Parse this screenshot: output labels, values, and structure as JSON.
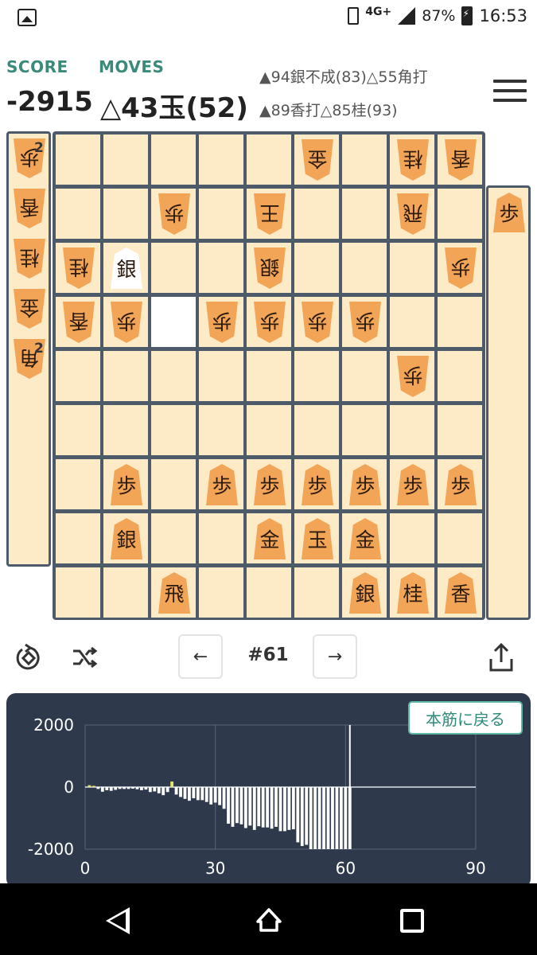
{
  "status_bar": {
    "network": "4G+",
    "battery": "87%",
    "time": "16:53"
  },
  "header": {
    "score_label": "SCORE",
    "moves_label": "MOVES",
    "score_value": "-2915",
    "move_value": "△43玉(52)",
    "pv_line1": "▲94銀不成(83)△55角打",
    "pv_line2": "▲89香打△85桂(93)"
  },
  "gote_hand": [
    {
      "piece": "歩",
      "count": "2"
    },
    {
      "piece": "香",
      "count": ""
    },
    {
      "piece": "桂",
      "count": ""
    },
    {
      "piece": "金",
      "count": ""
    },
    {
      "piece": "角",
      "count": "2"
    }
  ],
  "sente_hand": [
    {
      "piece": "歩",
      "count": ""
    }
  ],
  "board": [
    [
      "",
      "",
      "",
      "",
      "",
      "v金",
      "",
      "v桂",
      "v香"
    ],
    [
      "",
      "",
      "v歩",
      "",
      "v王",
      "",
      "",
      "v飛",
      ""
    ],
    [
      "v桂",
      "*銀",
      "",
      "",
      "v銀",
      "",
      "",
      "",
      "v歩"
    ],
    [
      "v香",
      "v歩",
      "#",
      "v歩",
      "v歩",
      "v歩",
      "v歩",
      "",
      ""
    ],
    [
      "",
      "",
      "",
      "",
      "",
      "",
      "",
      "v歩",
      ""
    ],
    [
      "",
      "",
      "",
      "",
      "",
      "",
      "",
      "",
      ""
    ],
    [
      "",
      "歩",
      "",
      "歩",
      "歩",
      "歩",
      "歩",
      "歩",
      "歩"
    ],
    [
      "",
      "銀",
      "",
      "",
      "金",
      "玉",
      "金",
      "",
      ""
    ],
    [
      "",
      "",
      "飛",
      "",
      "",
      "",
      "銀",
      "桂",
      "香"
    ]
  ],
  "controls": {
    "prev": "←",
    "next": "→",
    "move_number": "#61"
  },
  "chart_button": "本筋に戻る",
  "chart_data": {
    "type": "bar",
    "xlabel": "",
    "ylabel": "",
    "xlim": [
      0,
      90
    ],
    "ylim": [
      -2000,
      2000
    ],
    "yticks": [
      "2000",
      "0",
      "-2000"
    ],
    "xticks": [
      "0",
      "30",
      "60",
      "90"
    ],
    "current_move": 61,
    "x": [
      1,
      2,
      3,
      4,
      5,
      6,
      7,
      8,
      9,
      10,
      11,
      12,
      13,
      14,
      15,
      16,
      17,
      18,
      19,
      20,
      21,
      22,
      23,
      24,
      25,
      26,
      27,
      28,
      29,
      30,
      31,
      32,
      33,
      34,
      35,
      36,
      37,
      38,
      39,
      40,
      41,
      42,
      43,
      44,
      45,
      46,
      47,
      48,
      49,
      50,
      51,
      52,
      53,
      54,
      55,
      56,
      57,
      58,
      59,
      60,
      61
    ],
    "values": [
      60,
      40,
      -60,
      -150,
      -100,
      -120,
      -90,
      -60,
      -60,
      -60,
      -50,
      -70,
      -100,
      -80,
      -160,
      -140,
      -200,
      -260,
      -160,
      180,
      -240,
      -320,
      -380,
      -440,
      -360,
      -420,
      -420,
      -480,
      -560,
      -500,
      -580,
      -700,
      -1180,
      -1280,
      -1160,
      -1200,
      -1320,
      -1240,
      -1380,
      -1260,
      -1300,
      -1300,
      -1340,
      -1280,
      -1420,
      -1420,
      -1380,
      -1360,
      -1780,
      -1900,
      -1860,
      -2000,
      -2000,
      -2000,
      -2000,
      -2000,
      -2000,
      -2000,
      -2000,
      -2000,
      -2000
    ]
  },
  "icons": {
    "flip": "rotate-board-icon",
    "shuffle": "shuffle-icon",
    "share": "share-icon",
    "menu": "hamburger-menu-icon"
  }
}
